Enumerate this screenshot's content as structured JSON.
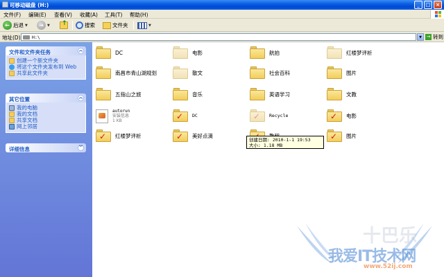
{
  "window": {
    "title": "可移动磁盘 (H:)",
    "buttons": [
      "_",
      "□",
      "×"
    ]
  },
  "menu": [
    "文件(F)",
    "编辑(E)",
    "查看(V)",
    "收藏(A)",
    "工具(T)",
    "帮助(H)"
  ],
  "toolbar": {
    "back": "后退",
    "search": "搜索",
    "folders": "文件夹"
  },
  "address": {
    "label": "地址(D)",
    "value": "H:\\",
    "go": "转到"
  },
  "tasks": {
    "file_tasks": {
      "title": "文件和文件夹任务",
      "items": [
        "创建一个新文件夹",
        "将这个文件夹发布到 Web",
        "共享此文件夹"
      ]
    },
    "other_places": {
      "title": "其它位置",
      "items": [
        "我的电脑",
        "我的文档",
        "共享文档",
        "网上邻居"
      ]
    },
    "details": {
      "title": "详细信息"
    }
  },
  "items": [
    {
      "name": "DC",
      "kind": "folder"
    },
    {
      "name": "电影",
      "kind": "folder"
    },
    {
      "name": "航拍",
      "kind": "folder"
    },
    {
      "name": "红楼梦评析",
      "kind": "folder"
    },
    {
      "name": "南昌市青山湖规划",
      "kind": "folder"
    },
    {
      "name": "散文",
      "kind": "folder"
    },
    {
      "name": "社会百科",
      "kind": "folder"
    },
    {
      "name": "图片",
      "kind": "folder"
    },
    {
      "name": "五指山之旅",
      "kind": "folder"
    },
    {
      "name": "音乐",
      "kind": "folder"
    },
    {
      "name": "英语学习",
      "kind": "folder"
    },
    {
      "name": "文教",
      "kind": "folder"
    },
    {
      "name": "autorun",
      "sub": "安装信息",
      "size": "1 KB",
      "kind": "file"
    },
    {
      "name": "DC",
      "kind": "folder-check"
    },
    {
      "name": "Recycle",
      "kind": "folder-check-pale"
    },
    {
      "name": "电影",
      "kind": "folder-check"
    },
    {
      "name": "红楼梦评析",
      "kind": "folder-check"
    },
    {
      "name": "美好点滴",
      "kind": "folder-check"
    },
    {
      "name": "教程",
      "kind": "folder-check"
    },
    {
      "name": "图片",
      "kind": "folder-check"
    }
  ],
  "tooltip": {
    "created": "创建日期: 2010-1-1 19:53",
    "size": "大小: 1.18 MB"
  },
  "watermark": {
    "text": "我爱IT技术网",
    "url": "www.52ij.com",
    "mark": "十巴乐"
  }
}
